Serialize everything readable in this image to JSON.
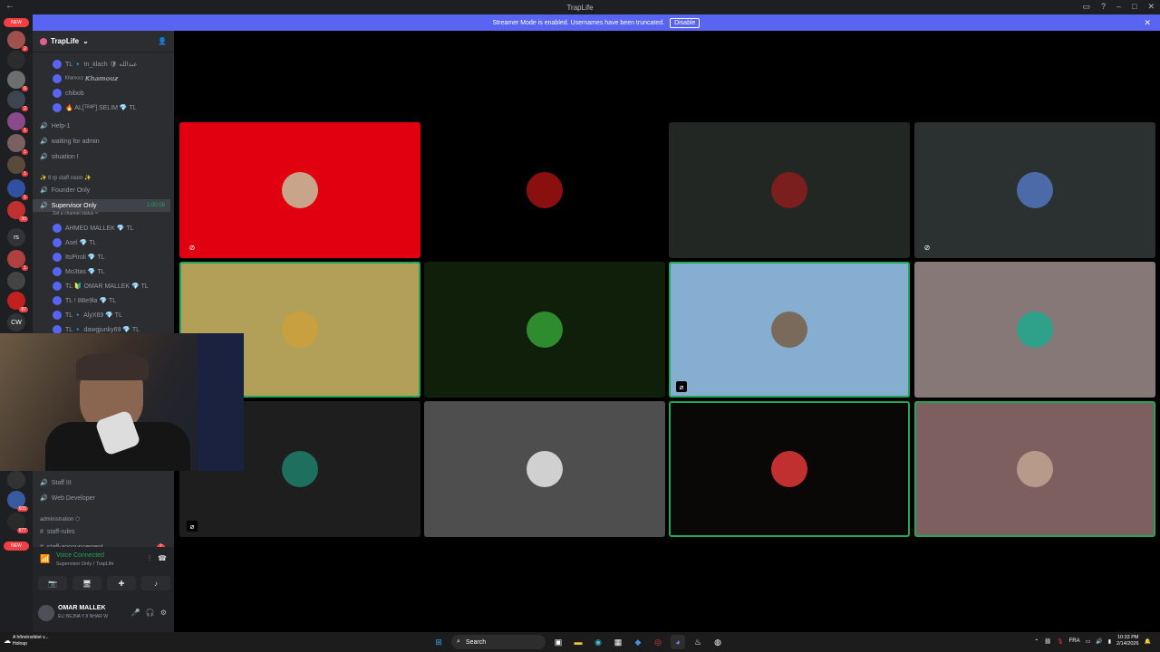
{
  "window": {
    "title": "TrapLife"
  },
  "banner": {
    "text": "Streamer Mode is enabled. Usernames have been truncated.",
    "button": "Disable"
  },
  "servers": {
    "new_top": "NEW",
    "new_bottom": "NEW",
    "rs": "rs",
    "cw": "CW",
    "badges": [
      "2",
      "6",
      "2",
      "1",
      "1",
      "1",
      "1",
      "30",
      "1",
      "87",
      "605",
      "677"
    ]
  },
  "guild": {
    "name": "TrapLife"
  },
  "channels": [
    {
      "type": "user",
      "name": "TL 🔹 tn_klach 🛡 ﻋﺒﺪﺍﻟﻠﻪ"
    },
    {
      "type": "user",
      "name": "ᴷʰᵃᵐᵒᵘᶻ 𝙆𝙝𝙖𝙢𝙤𝙪𝙯"
    },
    {
      "type": "user",
      "name": "chibob"
    },
    {
      "type": "user",
      "name": "🔥 AL[ᵀᴿᴬᴾ] SELIM 💎 TL"
    },
    {
      "type": "voice",
      "name": "Help-1"
    },
    {
      "type": "voice",
      "name": "waiting for admin"
    },
    {
      "type": "voice",
      "name": "situation I"
    },
    {
      "type": "category",
      "name": "✨ tl rp staff room ✨"
    },
    {
      "type": "voice",
      "name": "Founder Only"
    },
    {
      "type": "voice",
      "name": "Supervisor Only",
      "timer": "1:00:08",
      "status": "Set a channel status ✏"
    },
    {
      "type": "user",
      "name": "AHMED MALLEK 💎 TL"
    },
    {
      "type": "user",
      "name": "Asel 💎 TL"
    },
    {
      "type": "user",
      "name": "ItsPiroli 💎 TL"
    },
    {
      "type": "user",
      "name": "Mo3tas 💎 TL"
    },
    {
      "type": "user",
      "name": "TL 🔰 OMAR MALLEK 💎 TL"
    },
    {
      "type": "user",
      "name": "TL ! 8Be9la 💎 TL"
    },
    {
      "type": "user",
      "name": "TL 🔹 AlyX69 💎 TL"
    },
    {
      "type": "user",
      "name": "TL 🔹 dawgjunky69 💎 TL"
    },
    {
      "type": "voice",
      "name": "Staff III"
    },
    {
      "type": "voice",
      "name": "Web Developer"
    },
    {
      "type": "category",
      "name": "administration ⬡"
    },
    {
      "type": "text",
      "name": "staff-rules"
    },
    {
      "type": "text",
      "name": "staff-announcement",
      "badge": "2"
    }
  ],
  "voice": {
    "status": "Voice Connected",
    "location": "Supervisor Only / TrapLife"
  },
  "user": {
    "name": "OMAR MALLEK",
    "status": "ELI BEJNA YJI NHAR W"
  },
  "tiles": [
    {
      "color": "#e0000f",
      "avatar": "#c8a58a",
      "speaking": false,
      "icon": "mute"
    },
    {
      "color": "#000000",
      "avatar": "#8a1010",
      "speaking": false,
      "icon": ""
    },
    {
      "color": "#222724",
      "avatar": "#7a1e1e",
      "speaking": false,
      "icon": ""
    },
    {
      "color": "#2a3130",
      "avatar": "#4d6aa8",
      "speaking": false,
      "icon": "mute"
    },
    {
      "color": "#b29f58",
      "avatar": "#c8a040",
      "speaking": true,
      "icon": ""
    },
    {
      "color": "#0f1f0a",
      "avatar": "#2e8b2e",
      "speaking": false,
      "icon": ""
    },
    {
      "color": "#86aed1",
      "avatar": "#7a6a5a",
      "speaking": true,
      "icon": "deafen"
    },
    {
      "color": "#877878",
      "avatar": "#2fa08a",
      "speaking": false,
      "icon": ""
    },
    {
      "color": "#1e1e1e",
      "avatar": "#1f6f5f",
      "speaking": false,
      "icon": "deafen"
    },
    {
      "color": "#4e4e4e",
      "avatar": "#d0d0d0",
      "speaking": false,
      "icon": ""
    },
    {
      "color": "#0a0707",
      "avatar": "#c03030",
      "speaking": true,
      "icon": ""
    },
    {
      "color": "#7d5f5f",
      "avatar": "#b89a8a",
      "speaking": true,
      "icon": ""
    }
  ],
  "taskbar": {
    "weather_line1": "A hőmérséklet v...",
    "weather_line2": "Holnap",
    "search": "Search",
    "lang": "FRA",
    "time": "10:33 PM",
    "date": "2/14/2026"
  }
}
